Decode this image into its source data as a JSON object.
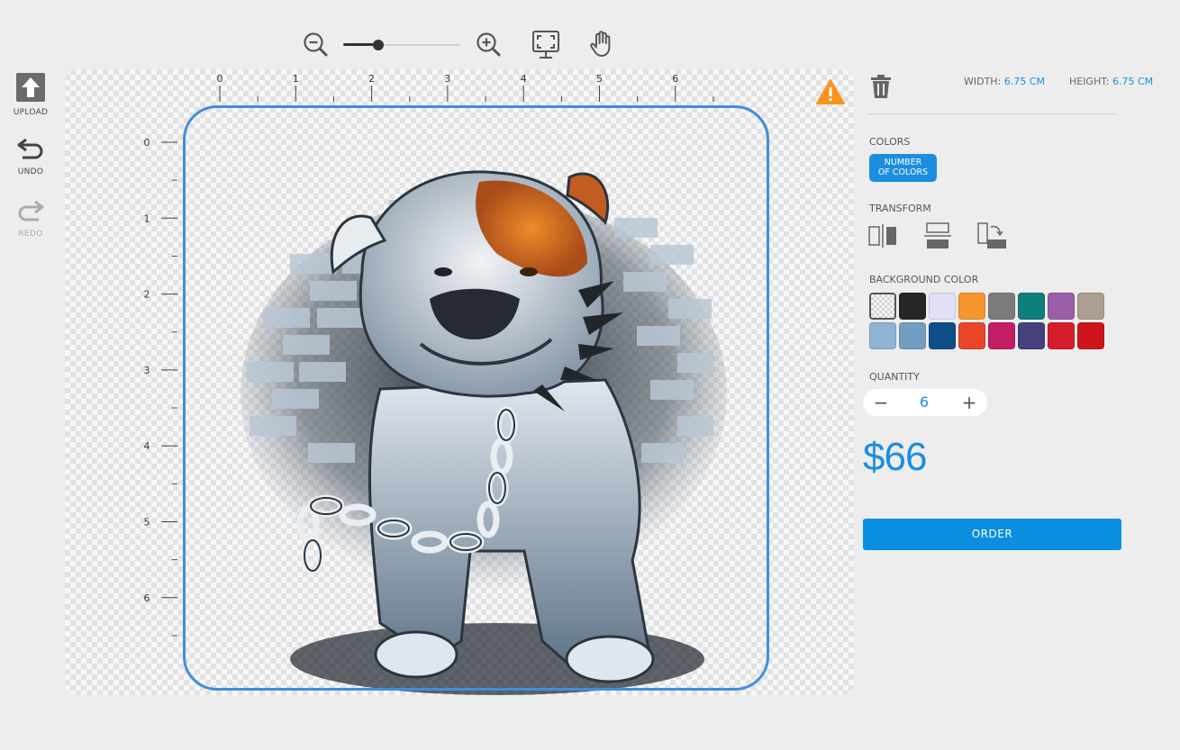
{
  "toolbar": {
    "zoom_level": 0.3,
    "icons": [
      "zoom-out-icon",
      "zoom-in-icon",
      "fit-screen-icon",
      "hand-pan-icon"
    ]
  },
  "left_tools": [
    {
      "label": "UPLOAD",
      "icon": "upload-icon",
      "enabled": true
    },
    {
      "label": "UNDO",
      "icon": "undo-icon",
      "enabled": true
    },
    {
      "label": "REDO",
      "icon": "redo-icon",
      "enabled": false
    }
  ],
  "canvas": {
    "h_ruler": [
      "0",
      "1",
      "2",
      "3",
      "4",
      "5",
      "6"
    ],
    "v_ruler": [
      "0",
      "1",
      "2",
      "3",
      "4",
      "5",
      "6"
    ],
    "artwork": "bulldog-with-chain-illustration",
    "warning_icon": "warning-triangle-icon"
  },
  "panel": {
    "width_label": "WIDTH:",
    "width_value": "6.75 CM",
    "height_label": "HEIGHT:",
    "height_value": "6.75 CM",
    "colors_heading": "COLORS",
    "colors_button_line1": "NUMBER",
    "colors_button_line2": "OF COLORS",
    "transform_heading": "TRANSFORM",
    "transform_icons": [
      "flip-horizontal-icon",
      "flip-vertical-icon",
      "rotate-icon"
    ],
    "background_heading": "BACKGROUND COLOR",
    "swatches": [
      "transparent",
      "#262626",
      "#e2e0f7",
      "#f7952f",
      "#7b7a7d",
      "#0f7f7c",
      "#9a5fa8",
      "#ac9f91",
      "#8fb3d2",
      "#729ec4",
      "#0d4e8a",
      "#e9452b",
      "#c41d64",
      "#43427a",
      "#d51d2b",
      "#d0141b"
    ],
    "selected_swatch": 0,
    "quantity_heading": "QUANTITY",
    "quantity_minus": "−",
    "quantity_value": "6",
    "quantity_plus": "+",
    "price": "$66",
    "order_label": "ORDER"
  },
  "colors": {
    "accent": "#1b8ee0",
    "print_area_border": "#3f8fdb",
    "warning": "#f7941d"
  }
}
